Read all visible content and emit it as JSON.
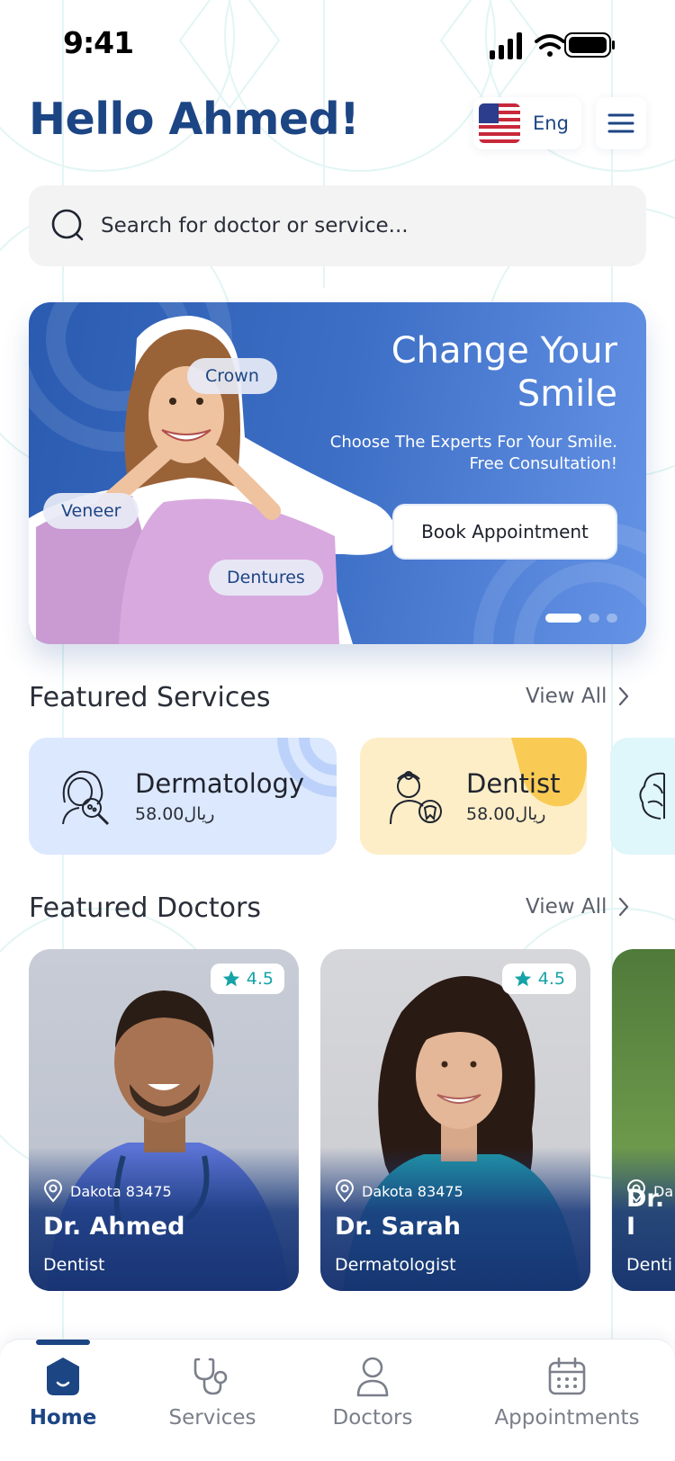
{
  "status_bar": {
    "time": "9:41"
  },
  "header": {
    "greeting": "Hello Ahmed!",
    "language": "Eng"
  },
  "search": {
    "placeholder": "Search for doctor or service..."
  },
  "banner": {
    "title": "Change Your Smile",
    "subtitle_line1": "Choose The Experts For Your Smile.",
    "subtitle_line2": "Free Consultation!",
    "button": "Book Appointment",
    "tags": [
      "Crown",
      "Veneer",
      "Dentures"
    ],
    "slides": 3,
    "active_slide": 1
  },
  "featured_services": {
    "title": "Featured Services",
    "view_all": "View All",
    "items": [
      {
        "name": "Dermatology",
        "price": "58.00ريال",
        "icon": "dermatology-icon",
        "color": "#dce8fd"
      },
      {
        "name": "Dentist",
        "price": "58.00ريال",
        "icon": "dentist-icon",
        "color": "#fdeec7"
      },
      {
        "name": "",
        "price": "",
        "icon": "brain-icon",
        "color": "#dff6fb"
      }
    ]
  },
  "featured_doctors": {
    "title": "Featured Doctors",
    "view_all": "View All",
    "items": [
      {
        "name": "Dr. Ahmed",
        "specialty": "Dentist",
        "location": "Dakota 83475",
        "rating": "4.5"
      },
      {
        "name": "Dr. Sarah",
        "specialty": "Dermatologist",
        "location": "Dakota 83475",
        "rating": "4.5"
      },
      {
        "name": "Dr. I",
        "specialty": "Denti",
        "location": "Da",
        "rating": ""
      }
    ]
  },
  "bottom_nav": {
    "items": [
      {
        "label": "Home",
        "icon": "home-icon",
        "active": true
      },
      {
        "label": "Services",
        "icon": "stethoscope-icon",
        "active": false
      },
      {
        "label": "Doctors",
        "icon": "person-icon",
        "active": false
      },
      {
        "label": "Appointments",
        "icon": "calendar-icon",
        "active": false
      }
    ]
  },
  "colors": {
    "primary": "#1c4584",
    "accent": "#16a3a8",
    "banner": "#3d6fc6"
  }
}
